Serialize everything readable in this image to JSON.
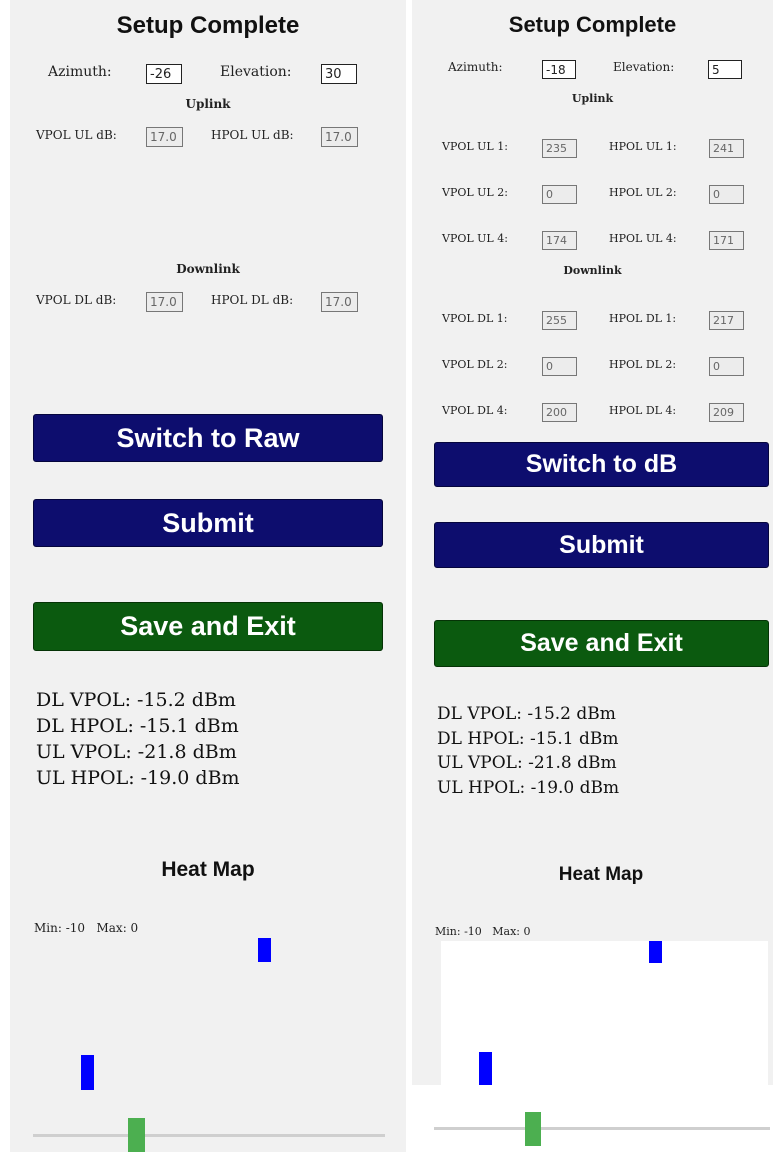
{
  "left": {
    "title": "Setup Complete",
    "azimuth_label": "Azimuth:",
    "azimuth_value": "-26",
    "elevation_label": "Elevation:",
    "elevation_value": "30",
    "uplink_heading": "Uplink",
    "vpol_ul_label": "VPOL UL dB:",
    "vpol_ul_value": "17.0",
    "hpol_ul_label": "HPOL UL dB:",
    "hpol_ul_value": "17.0",
    "downlink_heading": "Downlink",
    "vpol_dl_label": "VPOL DL dB:",
    "vpol_dl_value": "17.0",
    "hpol_dl_label": "HPOL DL dB:",
    "hpol_dl_value": "17.0",
    "switch_button": "Switch to Raw",
    "submit_button": "Submit",
    "save_button": "Save and Exit",
    "stats": [
      "DL VPOL: -15.2 dBm",
      "DL HPOL: -15.1 dBm",
      "UL VPOL: -21.8 dBm",
      "UL HPOL: -19.0 dBm"
    ],
    "heatmap_title": "Heat Map",
    "heatmap_minmax": "Min: -10   Max: 0"
  },
  "right": {
    "title": "Setup Complete",
    "azimuth_label": "Azimuth:",
    "azimuth_value": "-18",
    "elevation_label": "Elevation:",
    "elevation_value": "5",
    "uplink_heading": "Uplink",
    "uplink_rows": [
      {
        "vpol_label": "VPOL UL 1:",
        "vpol_value": "235",
        "hpol_label": "HPOL UL 1:",
        "hpol_value": "241"
      },
      {
        "vpol_label": "VPOL UL 2:",
        "vpol_value": "0",
        "hpol_label": "HPOL UL 2:",
        "hpol_value": "0"
      },
      {
        "vpol_label": "VPOL UL 4:",
        "vpol_value": "174",
        "hpol_label": "HPOL UL 4:",
        "hpol_value": "171"
      }
    ],
    "downlink_heading": "Downlink",
    "downlink_rows": [
      {
        "vpol_label": "VPOL DL 1:",
        "vpol_value": "255",
        "hpol_label": "HPOL DL 1:",
        "hpol_value": "217"
      },
      {
        "vpol_label": "VPOL DL 2:",
        "vpol_value": "0",
        "hpol_label": "HPOL DL 2:",
        "hpol_value": "0"
      },
      {
        "vpol_label": "VPOL DL 4:",
        "vpol_value": "200",
        "hpol_label": "HPOL DL 4:",
        "hpol_value": "209"
      }
    ],
    "switch_button": "Switch to dB",
    "submit_button": "Submit",
    "save_button": "Save and Exit",
    "stats": [
      "DL VPOL: -15.2 dBm",
      "DL HPOL: -15.1 dBm",
      "UL VPOL: -21.8 dBm",
      "UL HPOL: -19.0 dBm"
    ],
    "heatmap_title": "Heat Map",
    "heatmap_minmax": "Min: -10   Max: 0"
  },
  "colors": {
    "button_primary": "#0d0d6e",
    "button_save": "#0b5a0f",
    "heatmap_marker": "#0000ff",
    "slider_thumb": "#4caf50"
  }
}
